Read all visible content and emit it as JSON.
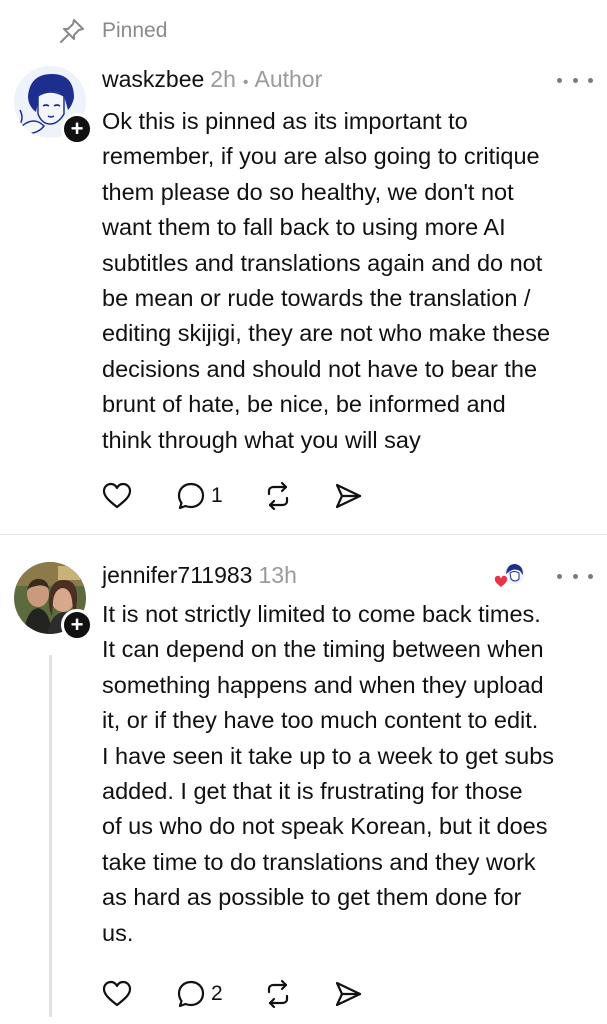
{
  "pinned": {
    "label": "Pinned",
    "icon": "pin-icon"
  },
  "comments": [
    {
      "username": "waskzbee",
      "time": "2h",
      "separator": "•",
      "author_tag": "Author",
      "avatar_icon": "avatar-drawing",
      "text": "Ok this is pinned as its important to\nremember, if you are also going to critique\nthem please do so healthy, we don't not\nwant them to fall back to using more AI\nsubtitles and translations again and do not\nbe mean or rude towards the translation /\nediting skijigi, they are not who make these\ndecisions and should not have to bear the\nbrunt of hate, be nice, be informed and\nthink through what you will say",
      "reply_count": "1",
      "plus_badge": "+"
    },
    {
      "username": "jennifer711983",
      "time": "13h",
      "avatar_icon": "avatar-photo",
      "liked_by_author_icon": "heart-author-avatar-icon",
      "text": "It is not strictly limited to come back times.\nIt can depend on the timing between when\nsomething happens and when they upload\nit, or if they have too much content to edit.\nI have seen it take up to a week to get subs\nadded.  I get that it is frustrating for those\nof us who do not speak Korean, but it does\ntake time to do translations and they work\nas hard as possible to get them done for\nus.",
      "reply_count": "2",
      "plus_badge": "+"
    }
  ],
  "colors": {
    "text": "#111111",
    "muted": "#9a9a9a",
    "divider": "#e4e4e4",
    "heart_red": "#e8344a",
    "badge_black": "#111111"
  }
}
